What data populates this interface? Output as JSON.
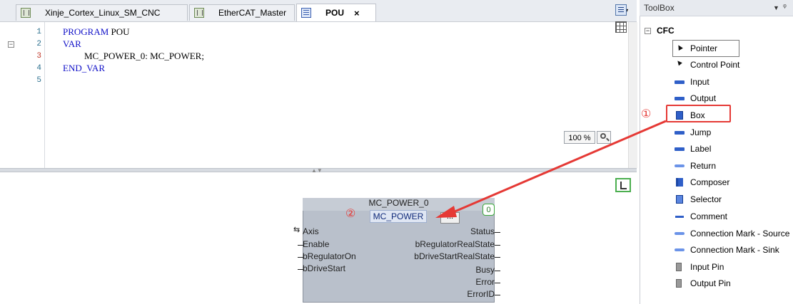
{
  "tabs": [
    {
      "label": "Xinje_Cortex_Linux_SM_CNC",
      "icon": "device-icon"
    },
    {
      "label": "EtherCAT_Master",
      "icon": "device-icon"
    },
    {
      "label": "POU",
      "icon": "pou-icon",
      "close": "×",
      "active": true
    }
  ],
  "editor": {
    "line_numbers": [
      "1",
      "2",
      "3",
      "4",
      "5"
    ],
    "fold_marker": "−",
    "lines": {
      "l1_kw": "PROGRAM",
      "l1_name": " POU",
      "l2_kw": "VAR",
      "l3_text": "MC_POWER_0: MC_POWER;",
      "l4_kw": "END_VAR"
    },
    "zoom": "100 %"
  },
  "fb": {
    "instance": "MC_POWER_0",
    "type": "MC_POWER",
    "ellipsis": "...",
    "order": "0",
    "inputs": [
      "Axis",
      "Enable",
      "bRegulatorOn",
      "bDriveStart"
    ],
    "outputs": [
      "Status",
      "bRegulatorRealState",
      "bDriveStartRealState",
      "Busy",
      "Error",
      "ErrorID"
    ],
    "axis_glyph": "⇆"
  },
  "toolbox": {
    "title": "ToolBox",
    "dropdown": "▼",
    "pin": "ᵠ",
    "group": "CFC",
    "collapse": "−",
    "items": [
      {
        "label": "Pointer",
        "icon": "pointer-icon"
      },
      {
        "label": "Control Point",
        "icon": "control-point-icon"
      },
      {
        "label": "Input",
        "icon": "input-icon"
      },
      {
        "label": "Output",
        "icon": "output-icon"
      },
      {
        "label": "Box",
        "icon": "box-icon"
      },
      {
        "label": "Jump",
        "icon": "jump-icon"
      },
      {
        "label": "Label",
        "icon": "label-icon"
      },
      {
        "label": "Return",
        "icon": "return-icon"
      },
      {
        "label": "Composer",
        "icon": "composer-icon"
      },
      {
        "label": "Selector",
        "icon": "selector-icon"
      },
      {
        "label": "Comment",
        "icon": "comment-icon"
      },
      {
        "label": "Connection Mark - Source",
        "icon": "connection-mark-source-icon"
      },
      {
        "label": "Connection Mark - Sink",
        "icon": "connection-mark-sink-icon"
      },
      {
        "label": "Input Pin",
        "icon": "input-pin-icon"
      },
      {
        "label": "Output Pin",
        "icon": "output-pin-icon"
      }
    ]
  },
  "annotations": {
    "callout_1": "①",
    "callout_2": "②",
    "color": "#e53935"
  }
}
